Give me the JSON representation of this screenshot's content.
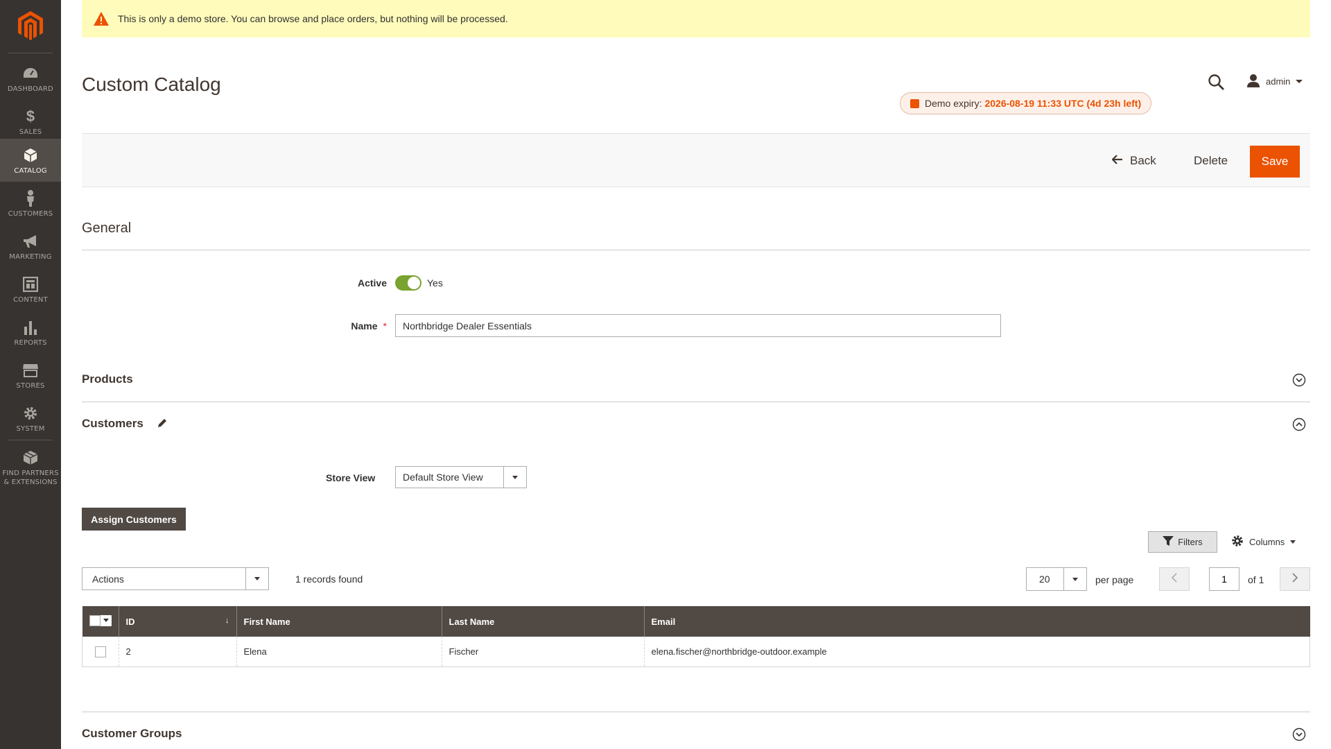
{
  "sidebar": {
    "items": [
      {
        "label": "DASHBOARD",
        "icon": "dashboard-icon"
      },
      {
        "label": "$",
        "icon": "sales-icon"
      },
      {
        "label": "SALES",
        "icon": "sales-icon"
      },
      {
        "label": "CATALOG",
        "icon": "catalog-icon"
      },
      {
        "label": "CUSTOMERS",
        "icon": "customers-icon"
      },
      {
        "label": "MARKETING",
        "icon": "marketing-icon"
      },
      {
        "label": "CONTENT",
        "icon": "content-icon"
      },
      {
        "label": "REPORTS",
        "icon": "reports-icon"
      },
      {
        "label": "STORES",
        "icon": "stores-icon"
      },
      {
        "label": "SYSTEM",
        "icon": "system-icon"
      },
      {
        "label": "FIND PARTNERS & EXTENSIONS",
        "icon": "extensions-icon"
      }
    ],
    "active": "CATALOG"
  },
  "notice": {
    "text": "This is only a demo store. You can browse and place orders, but nothing will be processed."
  },
  "header": {
    "title": "Custom Catalog",
    "user": "admin",
    "demo_expiry_label": "Demo expiry:",
    "demo_expiry_value": "2026-08-19 11:33 UTC (4d 23h left)"
  },
  "actions": {
    "back": "Back",
    "delete": "Delete",
    "save": "Save"
  },
  "general": {
    "heading": "General",
    "active_label": "Active",
    "active_value": "Yes",
    "active_on": true,
    "name_label": "Name",
    "name_required": "*",
    "name_value": "Northbridge Dealer Essentials"
  },
  "sections": {
    "products": "Products",
    "customers": "Customers",
    "customer_groups": "Customer Groups"
  },
  "customers": {
    "store_view_label": "Store View",
    "store_view_value": "Default Store View",
    "assign_button": "Assign Customers",
    "filters": "Filters",
    "columns": "Columns",
    "actions_select": "Actions",
    "records_found": "1 records found",
    "per_page_value": "20",
    "per_page_label": "per page",
    "page_value": "1",
    "page_of": "of 1",
    "table": {
      "headers": [
        "ID",
        "First Name",
        "Last Name",
        "Email"
      ],
      "rows": [
        [
          "2",
          "Elena",
          "Fischer",
          "elena.fischer@northbridge-outdoor.example"
        ]
      ]
    }
  },
  "colors": {
    "accent": "#eb5202",
    "sidebar": "#373330",
    "toggle_on": "#79a22e",
    "grid_header": "#514943"
  }
}
